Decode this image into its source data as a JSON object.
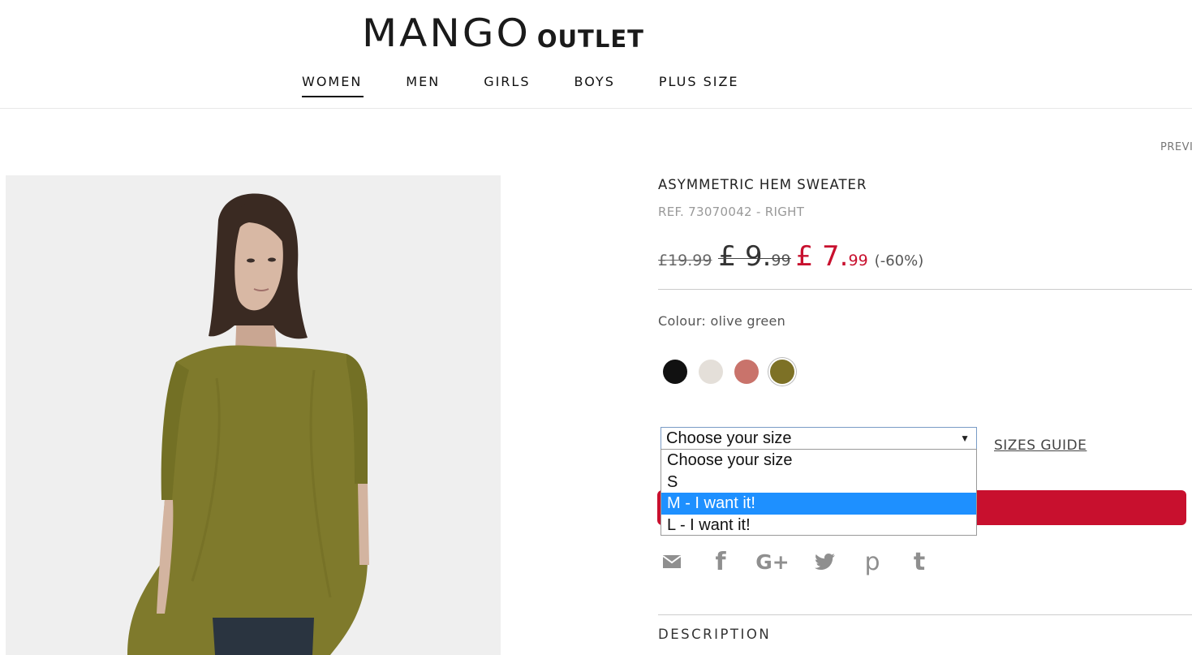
{
  "header": {
    "logo_main": "MANGO",
    "logo_sub": "OUTLET",
    "nav": [
      {
        "label": "WOMEN",
        "active": true
      },
      {
        "label": "MEN",
        "active": false
      },
      {
        "label": "GIRLS",
        "active": false
      },
      {
        "label": "BOYS",
        "active": false
      },
      {
        "label": "PLUS SIZE",
        "active": false
      }
    ],
    "prev_label": "PREVI"
  },
  "product": {
    "title": "ASYMMETRIC HEM SWEATER",
    "ref": "REF. 73070042 - RIGHT",
    "price": {
      "original": "£19.99",
      "previous_currency": "£ ",
      "previous_whole": "9.",
      "previous_decimals": "99",
      "current_currency": "£ ",
      "current_whole": "7.",
      "current_decimals": "99",
      "discount": "(-60%)"
    },
    "colour_label": "Colour: olive green",
    "swatches": [
      {
        "name": "black",
        "color": "#111111",
        "selected": false
      },
      {
        "name": "off-white",
        "color": "#e4dfd9",
        "selected": false
      },
      {
        "name": "pink",
        "color": "#c9736b",
        "selected": false
      },
      {
        "name": "olive green",
        "color": "#7d7126",
        "selected": true
      }
    ],
    "size_select": {
      "selected": "Choose your size",
      "options": [
        "Choose your size",
        "S",
        "M - I want it!",
        "L - I want it!"
      ],
      "highlighted_index": 2
    },
    "sizes_guide": "SIZES GUIDE",
    "description_label": "DESCRIPTION"
  },
  "colors": {
    "accent_red": "#c8102e",
    "select_highlight": "#1e90ff",
    "icon_grey": "#8f8f8f"
  },
  "share": [
    {
      "icon": "email-icon"
    },
    {
      "icon": "facebook-icon",
      "glyph": "f"
    },
    {
      "icon": "google-plus-icon",
      "glyph": "G+"
    },
    {
      "icon": "twitter-icon"
    },
    {
      "icon": "pinterest-icon",
      "glyph": "p"
    },
    {
      "icon": "tumblr-icon",
      "glyph": "t"
    }
  ]
}
